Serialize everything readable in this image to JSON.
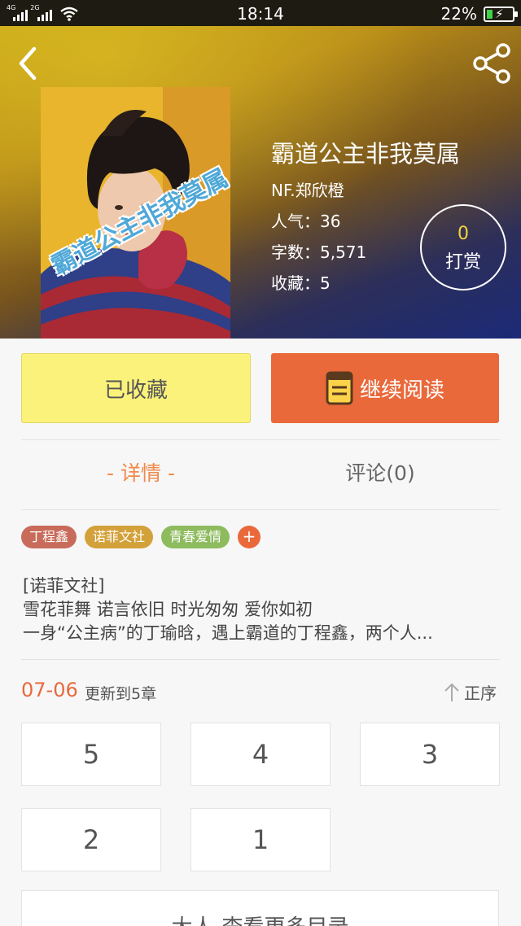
{
  "status_bar": {
    "net_label_1": "4G",
    "net_label_2": "2G",
    "time": "18:14",
    "battery_percent": "22%",
    "battery_level": 0.22,
    "battery_color": "#3fd34a"
  },
  "header": {
    "back_icon": "chevron-left-icon",
    "share_icon": "share-icon"
  },
  "book": {
    "title": "霸道公主非我莫属",
    "cover_text": "霸道公主非我莫属",
    "author": "NF.郑欣橙",
    "popularity": "人气：36",
    "word_count": "字数：5,571",
    "favorites": "收藏：5"
  },
  "reward": {
    "count": "0",
    "label": "打赏"
  },
  "actions": {
    "collected_label": "已收藏",
    "read_label": "继续阅读",
    "read_icon": "book-icon"
  },
  "tabs": {
    "detail": "- 详情 -",
    "comment": "评论(0)"
  },
  "tags": [
    {
      "label": "丁程鑫",
      "color": "#c86b5a"
    },
    {
      "label": "诺菲文社",
      "color": "#d3a13a"
    },
    {
      "label": "青春爱情",
      "color": "#8dbb5e"
    }
  ],
  "tag_add_label": "+",
  "description": {
    "line1": "[诺菲文社]",
    "line2": "雪花菲舞 诺言依旧 时光匆匆 爱你如初",
    "line3": "一身“公主病”的丁瑜晗，遇上霸道的丁程鑫，两个人..."
  },
  "updates": {
    "date": "07-06",
    "text": "更新到5章",
    "sort_label": "正序"
  },
  "chapters": [
    "5",
    "4",
    "3",
    "2",
    "1"
  ],
  "more_label": "查看更多目录",
  "more_prefix": "大人",
  "colors": {
    "accent": "#e9693b",
    "collected_bg": "#fbf27b",
    "detail_tab": "#f08a4b"
  }
}
